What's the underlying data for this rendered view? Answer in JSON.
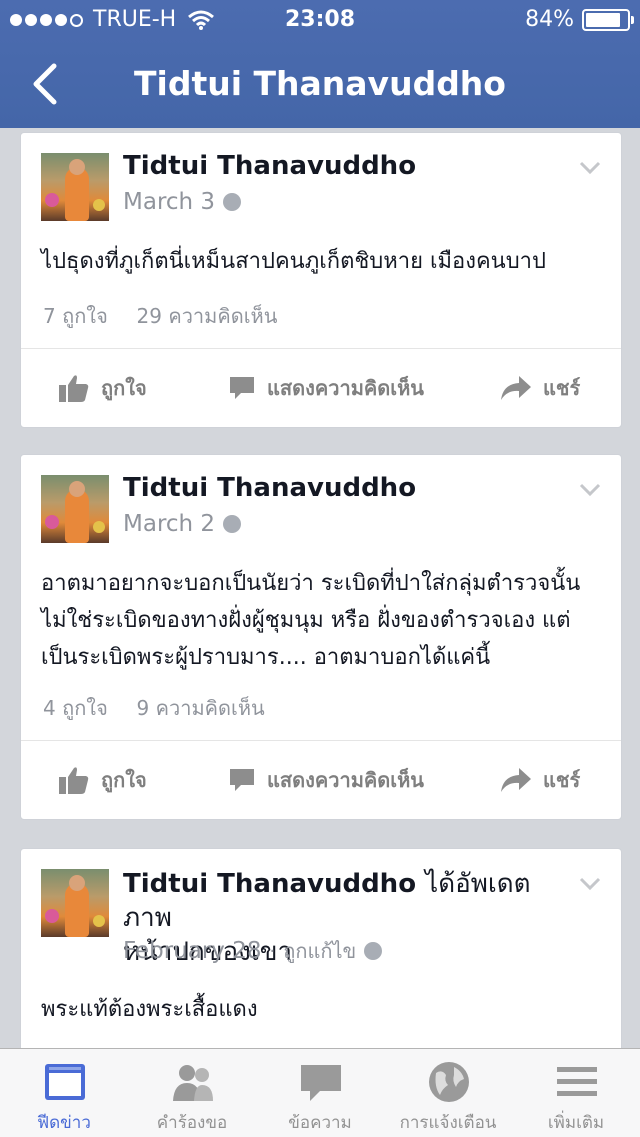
{
  "status_bar": {
    "carrier": "TRUE-H",
    "time": "23:08",
    "battery": "84%",
    "battery_level": 0.84
  },
  "nav": {
    "title": "Tidtui Thanavuddho"
  },
  "posts": [
    {
      "author": "Tidtui Thanavuddho",
      "author_suffix": "",
      "date": "March 3",
      "text": "ไปธุดงที่ภูเก็ตนี่เหม็นสาปคนภูเก็ตชิบหาย เมืองคนบาป",
      "likes": "7 ถูกใจ",
      "comments": "29 ความคิดเห็น",
      "like_label": "ถูกใจ",
      "comment_label": "แสดงความคิดเห็น",
      "share_label": "แชร์"
    },
    {
      "author": "Tidtui Thanavuddho",
      "author_suffix": "",
      "date": "March 2",
      "text": "อาตมาอยากจะบอกเป็นนัยว่า ระเบิดที่ปาใส่กลุ่มตำรวจนั้น ไม่ใช่ระเบิดของทางฝั่งผู้ชุมนุม หรือ ฝั่งของตำรวจเอง แต่เป็นระเบิดพระผู้ปราบมาร.... อาตมาบอกได้แค่นี้",
      "likes": "4 ถูกใจ",
      "comments": "9 ความคิดเห็น",
      "like_label": "ถูกใจ",
      "comment_label": "แสดงความคิดเห็น",
      "share_label": "แชร์"
    },
    {
      "author": "Tidtui Thanavuddho",
      "author_suffix": "ได้อัพเดตภาพ",
      "author_suffix_line2": "หน้าปกของเขา",
      "date": "February 28",
      "edited": "ถูกแก้ไข",
      "text": "พระแท้ต้องพระเสื้อแดง"
    }
  ],
  "tabs": [
    {
      "label": "ฟีดข่าว",
      "icon": "news-feed-icon"
    },
    {
      "label": "คำร้องขอ",
      "icon": "friend-requests-icon"
    },
    {
      "label": "ข้อความ",
      "icon": "messages-icon"
    },
    {
      "label": "การแจ้งเตือน",
      "icon": "notifications-globe-icon"
    },
    {
      "label": "เพิ่มเติม",
      "icon": "more-menu-icon"
    }
  ],
  "colors": {
    "header_blue": "#4c6cb0",
    "tab_active": "#4a6bd6",
    "tab_inactive": "#929292",
    "meta_gray": "#90949c"
  }
}
